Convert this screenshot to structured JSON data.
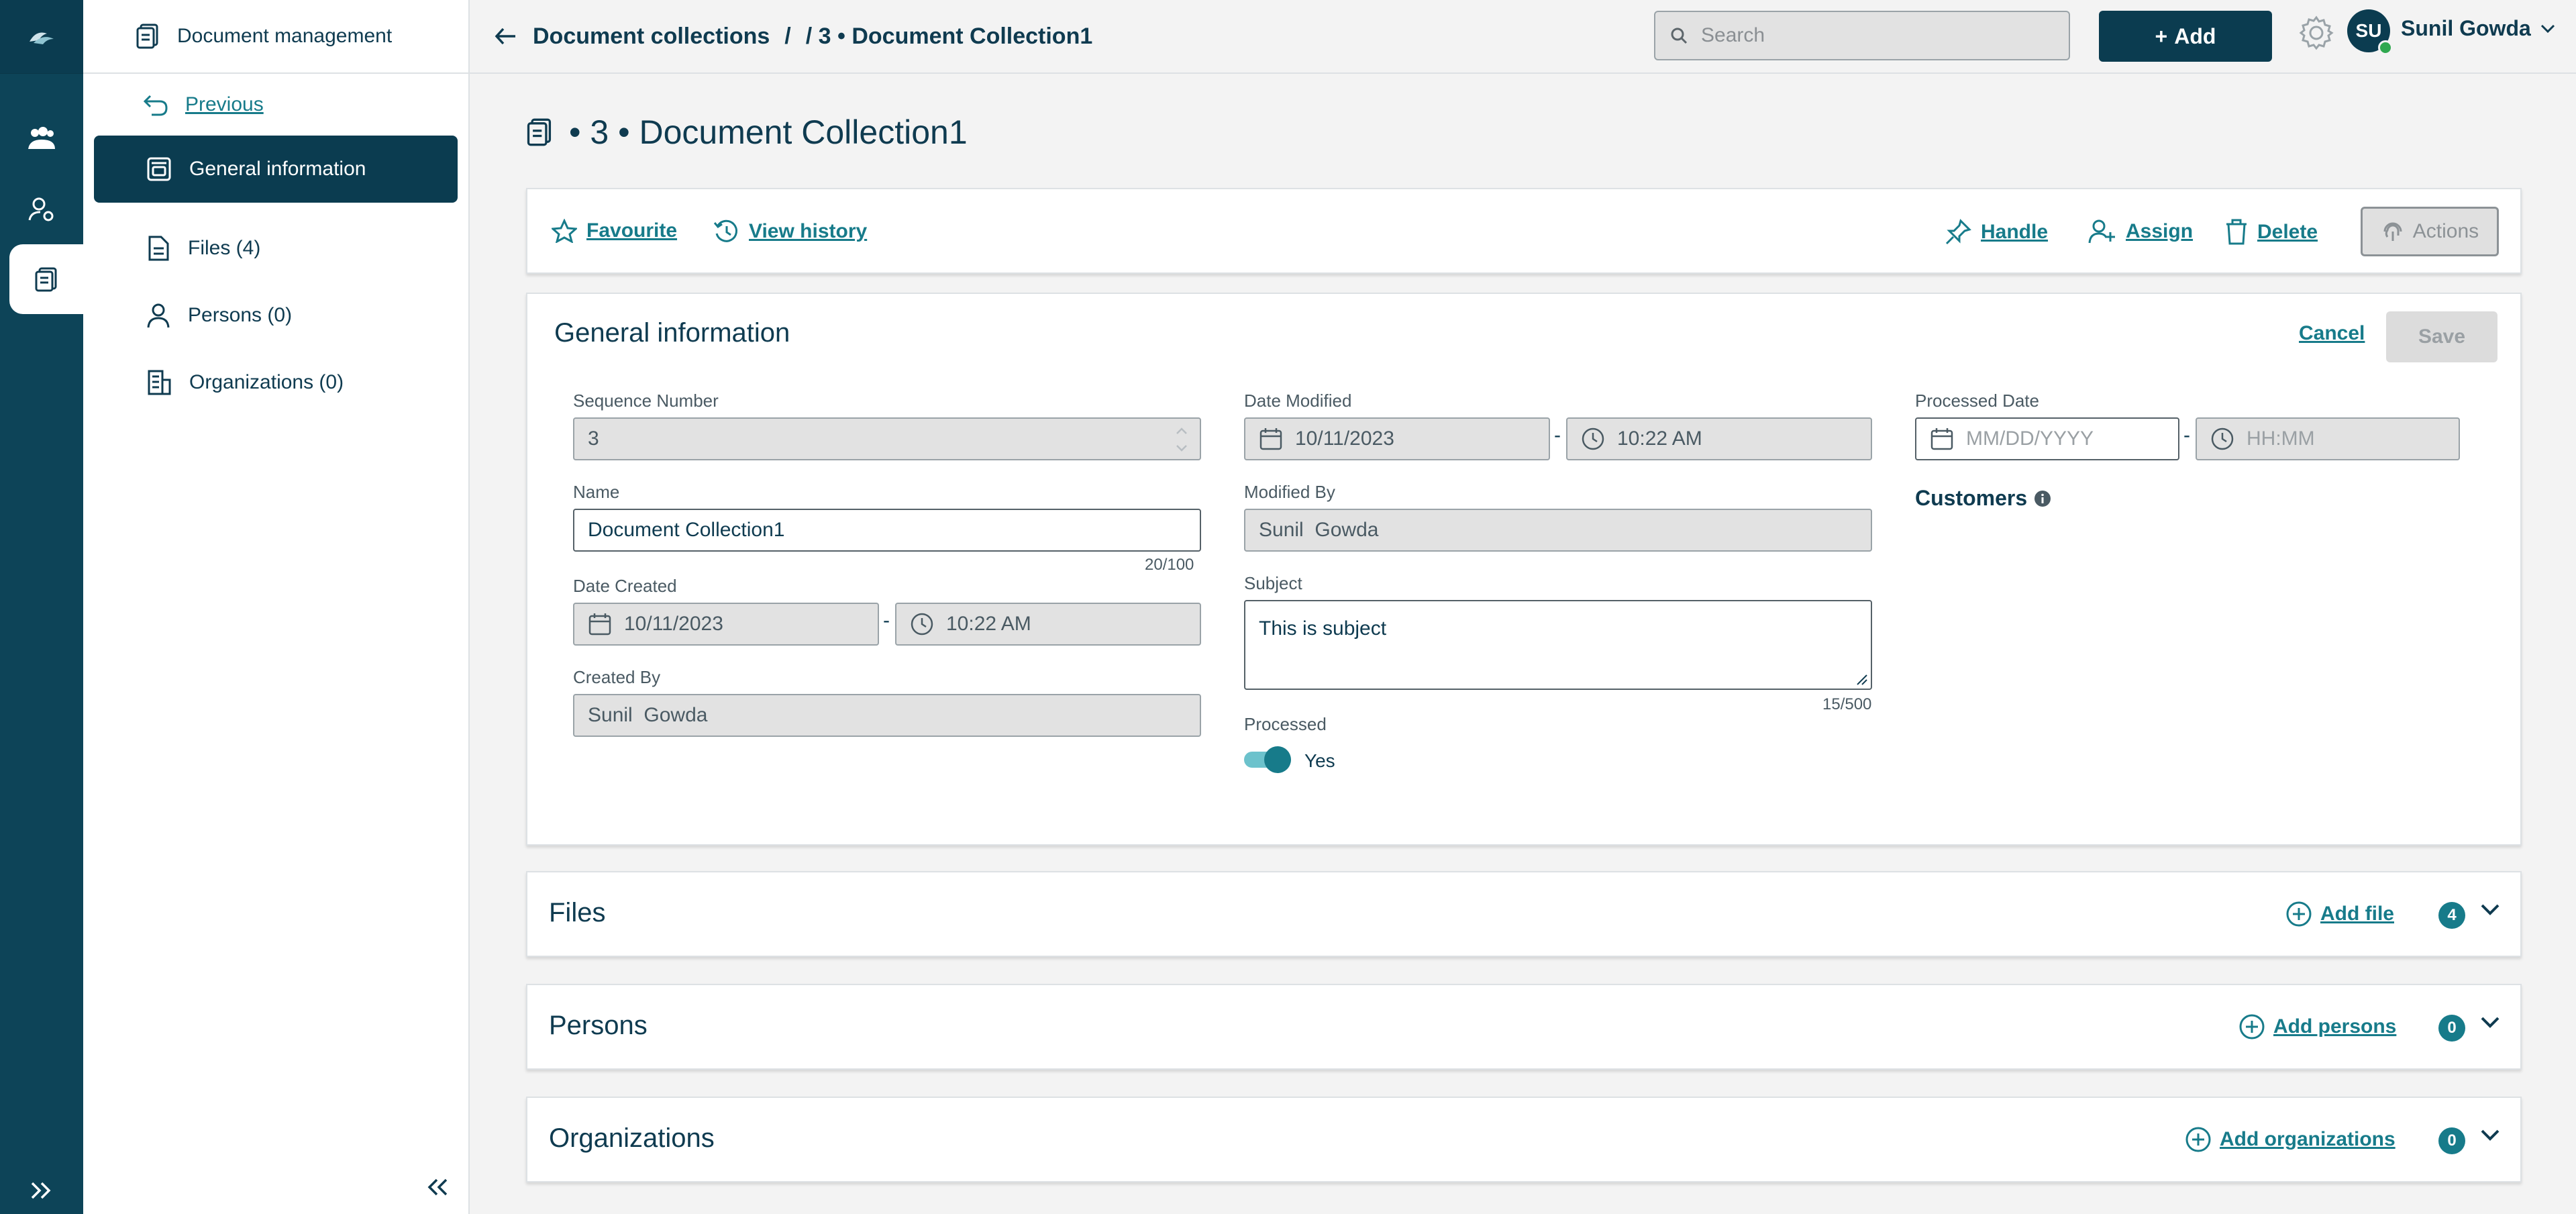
{
  "nav": {
    "header": "Document management",
    "previous": "Previous",
    "items": [
      {
        "label": "General information",
        "active": true
      },
      {
        "label": "Files (4)"
      },
      {
        "label": "Persons (0)"
      },
      {
        "label": "Organizations (0)"
      }
    ]
  },
  "topbar": {
    "breadcrumb_root": "Document collections",
    "breadcrumb_sep": "/",
    "breadcrumb_current": "/ 3 • Document Collection1",
    "search_placeholder": "Search",
    "add_label": "Add",
    "user_initials": "SU",
    "user_name": "Sunil Gowda"
  },
  "page": {
    "title": "• 3 • Document Collection1"
  },
  "toolbar": {
    "favourite": "Favourite",
    "view_history": "View history",
    "handle": "Handle",
    "assign": "Assign",
    "delete": "Delete",
    "actions": "Actions"
  },
  "general": {
    "heading": "General information",
    "cancel": "Cancel",
    "save": "Save",
    "sequence_label": "Sequence Number",
    "sequence_value": "3",
    "name_label": "Name",
    "name_value": "Document Collection1",
    "name_count": "20/100",
    "date_created_label": "Date Created",
    "date_created": "10/11/2023",
    "time_created": "10:22 AM",
    "created_by_label": "Created By",
    "created_by": "Sunil  Gowda",
    "date_modified_label": "Date Modified",
    "date_modified": "10/11/2023",
    "time_modified": "10:22 AM",
    "modified_by_label": "Modified By",
    "modified_by": "Sunil  Gowda",
    "subject_label": "Subject",
    "subject_value": "This is subject",
    "subject_count": "15/500",
    "processed_label": "Processed",
    "processed_value": "Yes",
    "processed_date_label": "Processed Date",
    "processed_date_placeholder": "MM/DD/YYYY",
    "processed_time_placeholder": "HH:MM",
    "customers_label": "Customers",
    "date_dash": "-"
  },
  "sections": {
    "files": {
      "title": "Files",
      "add": "Add file",
      "count": "4"
    },
    "persons": {
      "title": "Persons",
      "add": "Add persons",
      "count": "0"
    },
    "organizations": {
      "title": "Organizations",
      "add": "Add organizations",
      "count": "0"
    }
  },
  "colors": {
    "primary": "#0b3c50",
    "accent": "#177b8a",
    "disabled": "#e2e2e2"
  }
}
